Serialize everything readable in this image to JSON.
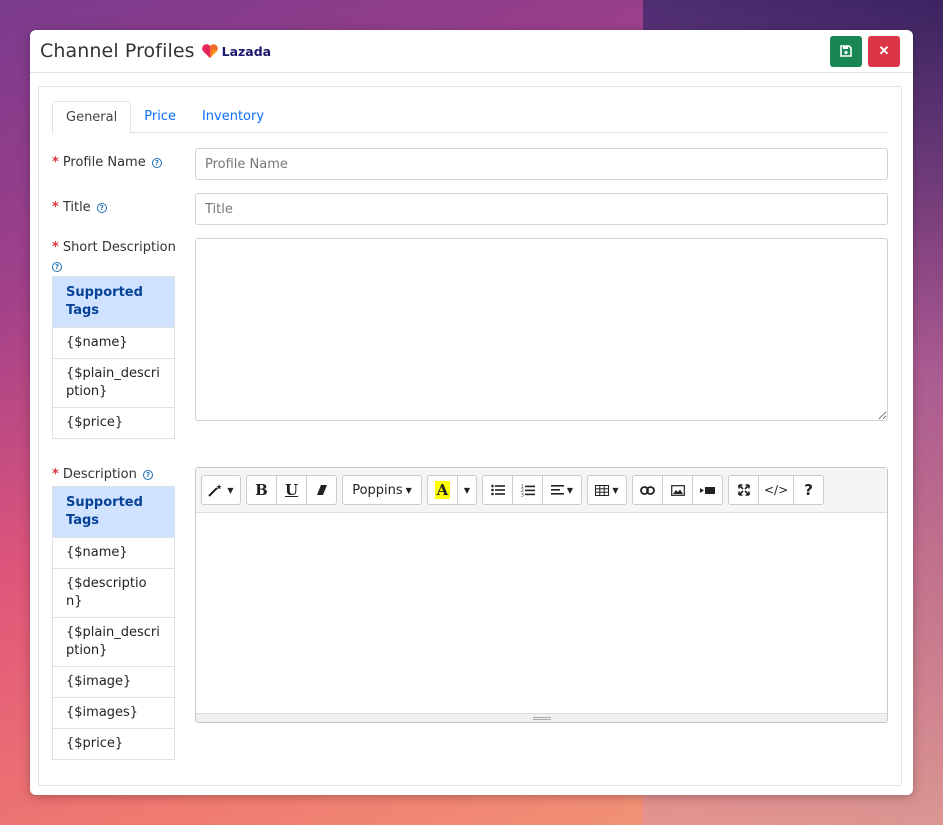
{
  "modal": {
    "title": "Channel Profiles",
    "brand": "Lazada"
  },
  "tabs": [
    {
      "label": "General"
    },
    {
      "label": "Price"
    },
    {
      "label": "Inventory"
    }
  ],
  "fields": {
    "profile_name": {
      "label": "Profile Name",
      "placeholder": "Profile Name"
    },
    "title": {
      "label": "Title",
      "placeholder": "Title"
    },
    "short_description": {
      "label": "Short Description"
    },
    "description": {
      "label": "Description"
    }
  },
  "short_tags": {
    "header": "Supported Tags",
    "items": [
      "{$name}",
      "{$plain_description}",
      "{$price}"
    ]
  },
  "desc_tags": {
    "header": "Supported Tags",
    "items": [
      "{$name}",
      "{$description}",
      "{$plain_description}",
      "{$image}",
      "{$images}",
      "{$price}"
    ]
  },
  "editor": {
    "font_name": "Poppins"
  },
  "colors": {
    "save": "#198754",
    "close": "#dc3545",
    "link": "#0d6efd",
    "tag_header_bg": "#cfe2ff"
  }
}
